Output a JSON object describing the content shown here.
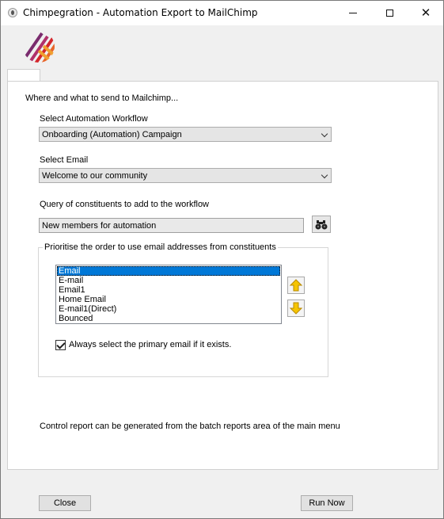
{
  "window": {
    "title": "Chimpegration - Automation Export to MailChimp"
  },
  "header": {
    "logo_icon": "chimpegration-stripes-logo"
  },
  "panel": {
    "intro": "Where and what to send to Mailchimp...",
    "workflow": {
      "label": "Select Automation Workflow",
      "value": "Onboarding (Automation) Campaign"
    },
    "email": {
      "label": "Select Email",
      "value": "Welcome to our community"
    },
    "query": {
      "label": "Query of constituents to add to the workflow",
      "value": "New members for automation",
      "search_icon": "binoculars-icon"
    },
    "priority": {
      "title": "Prioritise the order to use email addresses from constituents",
      "items": [
        "Email",
        "E-mail",
        "Email1",
        "Home Email",
        "E-mail1(Direct)",
        "Bounced"
      ],
      "selected_index": 0,
      "up_icon": "up-arrow-icon",
      "down_icon": "down-arrow-icon",
      "primary_checkbox": {
        "label": "Always select the primary email if it exists.",
        "checked": true
      }
    },
    "note": "Control report can be generated from the batch reports area of the main menu"
  },
  "footer": {
    "close_label": "Close",
    "run_label": "Run Now"
  },
  "colors": {
    "selection": "#0078d7",
    "arrow_fill": "#f5c400",
    "logo_red": "#d4262c",
    "logo_orange": "#f0a030",
    "logo_purple": "#7a2c6e"
  }
}
